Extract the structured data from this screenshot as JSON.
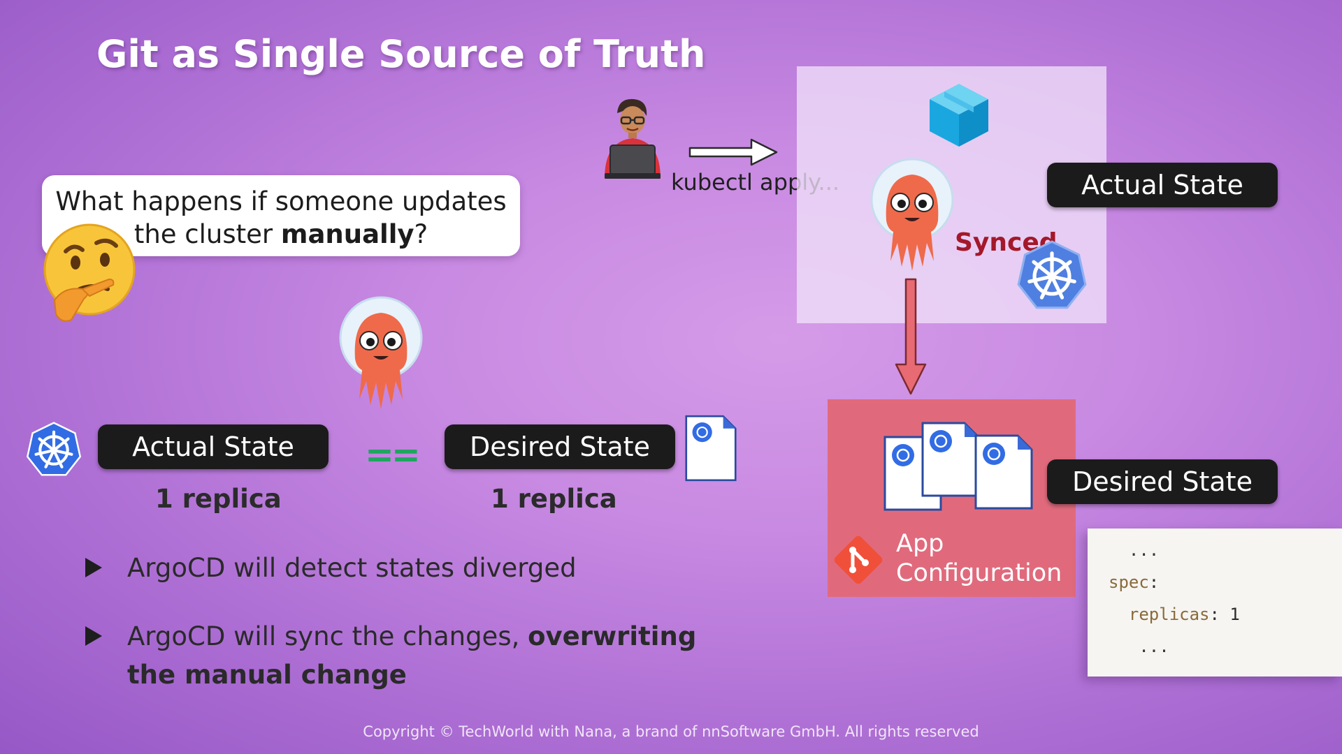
{
  "title": "Git as Single Source of Truth",
  "question": {
    "part1": "What happens if someone updates",
    "part2": "the cluster ",
    "emphasis": "manually",
    "end": "?"
  },
  "command": "kubectl apply...",
  "labels": {
    "actual_state": "Actual State",
    "desired_state": "Desired State",
    "equals": "==",
    "replica": "1 replica",
    "synced": "Synced",
    "app_configuration_line1": "App",
    "app_configuration_line2": "Configuration"
  },
  "bullets": [
    {
      "text": "ArgoCD will detect states diverged",
      "bold": ""
    },
    {
      "text": "ArgoCD will sync the changes, ",
      "bold": "overwriting the manual change"
    }
  ],
  "code": {
    "line1": "...",
    "key_spec": "spec",
    "key_replicas": "replicas",
    "value_replicas": "1",
    "line4": "..."
  },
  "copyright": "Copyright © TechWorld with Nana, a brand of nnSoftware GmbH. All rights reserved",
  "colors": {
    "pill_bg": "#1b1b1b",
    "equals": "#1fa55f",
    "synced": "#a3182a",
    "git_panel": "#e06a7c",
    "k8s_blue": "#326ce5",
    "argo_orange": "#ef6a4a"
  },
  "icons": [
    "thinking-face-icon",
    "developer-laptop-icon",
    "argo-octopus-icon",
    "kubernetes-wheel-icon",
    "package-cube-icon",
    "k8s-manifest-file-icon",
    "git-logo-icon",
    "arrow-right-icon",
    "arrow-down-icon",
    "bullet-triangle-icon"
  ]
}
